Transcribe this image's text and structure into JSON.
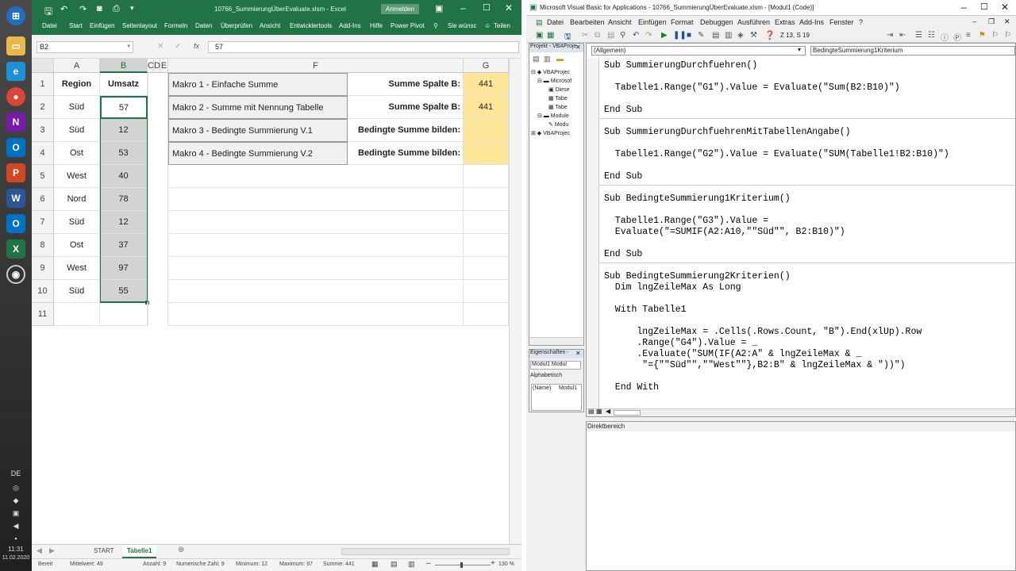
{
  "taskbar": {
    "lang": "DE",
    "time": "11:31",
    "date": "11.02.2020"
  },
  "excel": {
    "title": "10766_SummierungÜberEvaluate.xlsm - Excel",
    "signin": "Anmelden",
    "ribbon_tabs": [
      "Datei",
      "Start",
      "Einfügen",
      "Seitenlayout",
      "Formeln",
      "Daten",
      "Überprüfen",
      "Ansicht",
      "Entwicklertools",
      "Add-Ins",
      "Hilfe",
      "Power Pivot",
      "Sie wünsc",
      "Teilen"
    ],
    "namebox": "B2",
    "fx": "fx",
    "formula_value": "57",
    "columns": [
      "A",
      "B",
      "C",
      "D",
      "E",
      "F",
      "G"
    ],
    "rows": [
      "1",
      "2",
      "3",
      "4",
      "5",
      "6",
      "7",
      "8",
      "9",
      "10",
      "11"
    ],
    "col_a": [
      "Region",
      "Süd",
      "Süd",
      "Ost",
      "West",
      "Nord",
      "Süd",
      "Ost",
      "West",
      "Süd"
    ],
    "col_b": [
      "Umsatz",
      "57",
      "12",
      "53",
      "40",
      "78",
      "12",
      "37",
      "97",
      "55"
    ],
    "buttons": [
      "Makro 1 - Einfache Summe",
      "Makro 2 -  Summe mit Nennung Tabelle",
      "Makro 3 -  Bedingte Summierung V.1",
      "Makro 4 -  Bedingte Summierung V.2"
    ],
    "labels": [
      "Summe Spalte B:",
      "Summe Spalte B:",
      "Bedingte Summe bilden:",
      "Bedingte Summe bilden:"
    ],
    "results": [
      "441",
      "441",
      "",
      ""
    ],
    "sheet_tabs": {
      "start": "START",
      "active": "Tabelle1"
    },
    "status": {
      "ready": "Bereit",
      "mittelwert": "Mittelwert: 49",
      "anzahl": "Anzahl: 9",
      "numerisch": "Numerische Zahl: 9",
      "minimum": "Minimum: 12",
      "maximum": "Maximum: 97",
      "summe": "Summe: 441",
      "zoom": "130 %"
    }
  },
  "vba": {
    "title": "Microsoft Visual Basic for Applications - 10766_SummierungÜberEvaluate.xlsm - [Modul1 (Code)]",
    "menu": [
      "Datei",
      "Bearbeiten",
      "Ansicht",
      "Einfügen",
      "Format",
      "Debuggen",
      "Ausführen",
      "Extras",
      "Add-Ins",
      "Fenster",
      "?"
    ],
    "cursor_pos": "Z 13, S 19",
    "project_title": "Projekt - VBAProje",
    "project_tree": [
      "VBAProjec",
      "Microsof",
      "Diese",
      "Tabe",
      "Tabe",
      "Module",
      "Modu",
      "VBAProjec"
    ],
    "props_title": "Eigenschaften -",
    "props_object": "Modul1 Modul",
    "props_tab": "Alphabetisch",
    "props_name": "(Name)",
    "props_value": "Modul1",
    "combo_left": "(Allgemein)",
    "combo_right": "BedingteSummierung1Kriterium",
    "direkt_title": "Direktbereich",
    "code": [
      "Sub SummierungDurchfuehren()",
      "  Tabelle1.Range(\"G1\").Value = Evaluate(\"Sum(B2:B10)\")",
      "End Sub",
      "Sub SummierungDurchfuehrenMitTabellenAngabe()",
      "  Tabelle1.Range(\"G2\").Value = Evaluate(\"SUM(Tabelle1!B2:B10)\")",
      "End Sub",
      "Sub BedingteSummierung1Kriterium()",
      "  Tabelle1.Range(\"G3\").Value =",
      "  Evaluate(\"=SUMIF(A2:A10,\"\"Süd\"\", B2:B10)\")",
      "End Sub",
      "Sub BedingteSummierung2Kriterien()",
      "  Dim lngZeileMax As Long",
      "  With Tabelle1",
      "      lngZeileMax = .Cells(.Rows.Count, \"B\").End(xlUp).Row",
      "      .Range(\"G4\").Value = _",
      "      .Evaluate(\"SUM(IF(A2:A\" & lngZeileMax & _",
      "       \"={\"\"Süd\"\",\"\"West\"\"},B2:B\" & lngZeileMax & \"))\")",
      "  End With"
    ]
  }
}
